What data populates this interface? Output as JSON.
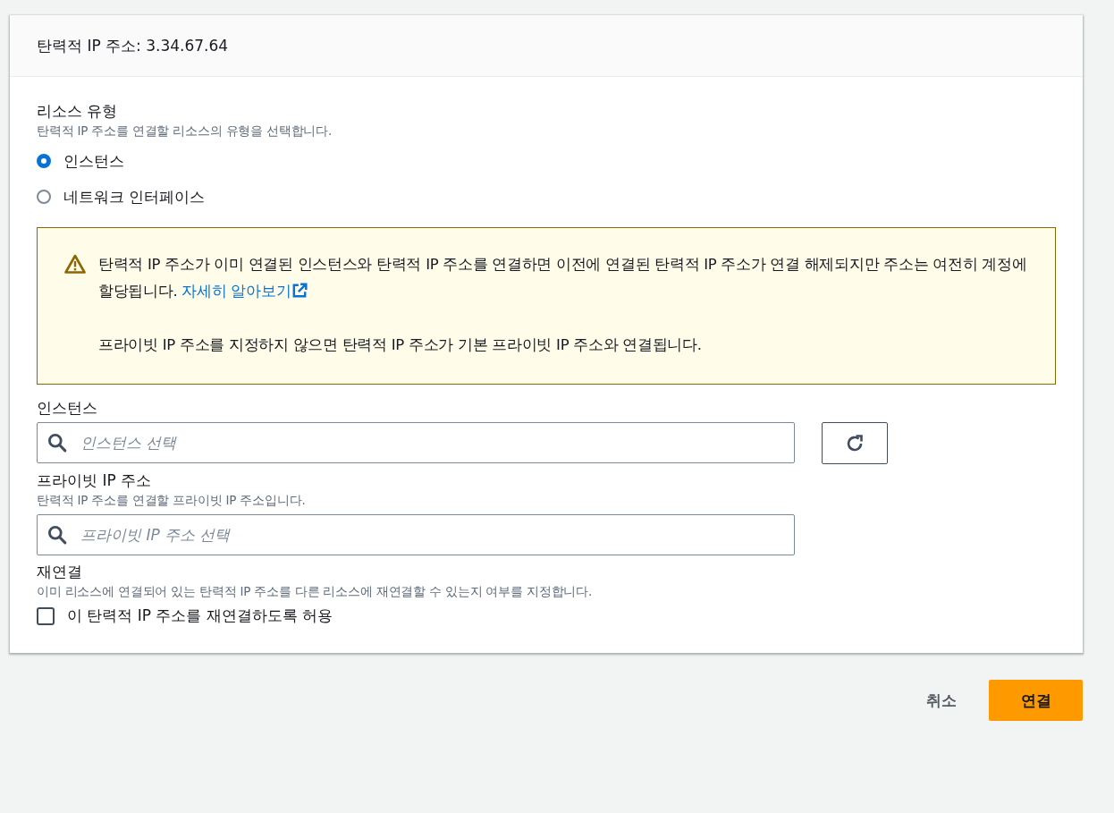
{
  "panel": {
    "title": "탄력적 IP 주소: 3.34.67.64"
  },
  "resource_type": {
    "label": "리소스 유형",
    "description": "탄력적 IP 주소를 연결할 리소스의 유형을 선택합니다.",
    "options": [
      {
        "label": "인스턴스",
        "selected": true
      },
      {
        "label": "네트워크 인터페이스",
        "selected": false
      }
    ]
  },
  "alert": {
    "text": "탄력적 IP 주소가 이미 연결된 인스턴스와 탄력적 IP 주소를 연결하면 이전에 연결된 탄력적 IP 주소가 연결 해제되지만 주소는 여전히 계정에 할당됩니다.",
    "link": "자세히 알아보기",
    "note": "프라이빗 IP 주소를 지정하지 않으면 탄력적 IP 주소가 기본 프라이빗 IP 주소와 연결됩니다."
  },
  "instance": {
    "label": "인스턴스",
    "placeholder": "인스턴스 선택"
  },
  "private_ip": {
    "label": "프라이빗 IP 주소",
    "description": "탄력적 IP 주소를 연결할 프라이빗 IP 주소입니다.",
    "placeholder": "프라이빗 IP 주소 선택"
  },
  "reassociation": {
    "label": "재연결",
    "description": "이미 리소스에 연결되어 있는 탄력적 IP 주소를 다른 리소스에 재연결할 수 있는지 여부를 지정합니다.",
    "checkbox": {
      "label": "이 탄력적 IP 주소를 재연결하도록 허용",
      "checked": false
    }
  },
  "buttons": {
    "cancel": "취소",
    "submit": "연결"
  }
}
